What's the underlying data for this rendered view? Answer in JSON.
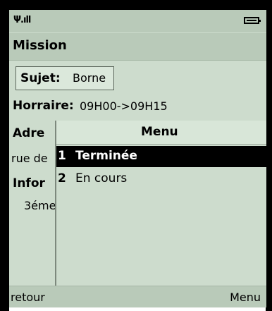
{
  "status": {
    "signal_icon": "signal-antenna-icon",
    "signal_text": "Ψ.ıll",
    "battery_icon": "battery-icon",
    "battery_level": 0.7
  },
  "title": "Mission",
  "subject": {
    "label": "Sujet:",
    "value": "Borne"
  },
  "horraire": {
    "label": "Horraire:",
    "value": "09H00->09H15"
  },
  "adresse": {
    "label": "Adre",
    "value": "rue de"
  },
  "information": {
    "label": "Infor",
    "value": "3éme"
  },
  "menu": {
    "title": "Menu",
    "items": [
      {
        "number": "1",
        "label": "Terminée",
        "selected": true
      },
      {
        "number": "2",
        "label": "En cours",
        "selected": false
      }
    ]
  },
  "softkeys": {
    "left": "retour",
    "right": "Menu"
  },
  "colors": {
    "screen_bg": "#cddccd",
    "bar_bg": "#b9cab9",
    "selection_bg": "#000000",
    "selection_fg": "#ffffff"
  }
}
